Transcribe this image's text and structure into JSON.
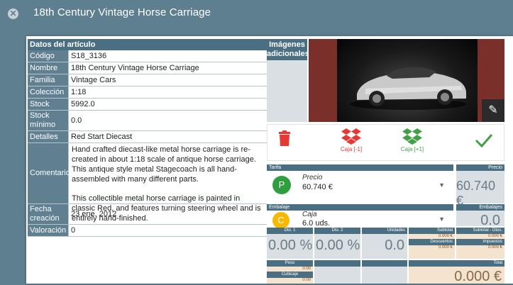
{
  "window": {
    "title": "18th Century Vintage Horse Carriage"
  },
  "datos": {
    "header": "Datos del artículo",
    "rows": [
      {
        "label": "Código",
        "value": "S18_3136"
      },
      {
        "label": "Nombre",
        "value": "18th Century Vintage Horse Carriage"
      },
      {
        "label": "Familia",
        "value": "Vintage Cars"
      },
      {
        "label": "Colección",
        "value": "1:18"
      },
      {
        "label": "Stock",
        "value": "5992.0"
      },
      {
        "label": "Stock mínimo",
        "value": "0.0"
      },
      {
        "label": "Detalles",
        "value": "Red Start Diecast"
      }
    ],
    "comentario_label": "Comentario",
    "comentario_p1": "Hand crafted diecast-like metal horse carriage is re-created in about 1:18 scale of antique horse carriage. This antique style metal Stagecoach is all hand-assembled with many different parts.",
    "comentario_p2": "This collectible metal horse carriage is painted in classic Red, and features turning steering wheel and is entirely hand-finished.",
    "fecha_label": "Fecha creación",
    "fecha_value": "23 ene. 2012",
    "valoracion_label": "Valoración",
    "valoracion_value": "0"
  },
  "imagenes": {
    "header": "Imágenes adicionales"
  },
  "actions": {
    "caja_minus": "Caja [-1]",
    "caja_plus": "Caja [+1]"
  },
  "tarifa": {
    "header": "Tarifa",
    "circle": "P",
    "label": "Precio",
    "value": "60.740 €"
  },
  "precio": {
    "header": "Precio",
    "value": "60.740 €"
  },
  "embalaje": {
    "header": "Embalaje",
    "circle": "C",
    "label": "Caja",
    "value": "6.0 uds."
  },
  "embalajes": {
    "header": "Embalajes",
    "value": "0.0"
  },
  "totals": {
    "dto1_header": "Dto. 1",
    "dto1_value": "0.00 %",
    "dto2_header": "Dto. 2",
    "dto2_value": "0.00 %",
    "unidades_header": "Unidades",
    "unidades_value": "0.0",
    "subtotal_header": "Subtotal",
    "subtotal_value": "0.000 €",
    "descuentos_header": "Descuentos",
    "descuentos_value": "0.000 €",
    "subtotal_dtos_header": "Subtotal - Dtos.",
    "subtotal_dtos_value": "0.000 €",
    "impuestos_header": "Impuestos",
    "impuestos_value": "0.000 €",
    "peso_header": "Peso",
    "peso_value": "0.00",
    "cubicaje_header": "Cubicaje",
    "cubicaje_value": "0.00",
    "total_header": "Total",
    "total_value": "0.000 €"
  },
  "colors": {
    "header": "#4a6f82",
    "label_bg": "#607f91",
    "delete": "#e53935",
    "caja_minus": "#e53935",
    "caja_plus": "#43a047",
    "confirm": "#43a047",
    "tarifa_circle": "#2e9e3f",
    "embalaje_circle": "#f9b800"
  },
  "icons": {
    "close": "close-icon",
    "edit": "pencil-icon",
    "delete": "trash-icon",
    "caja_minus": "dropbox-icon",
    "caja_plus": "dropbox-icon",
    "confirm": "check-icon"
  }
}
